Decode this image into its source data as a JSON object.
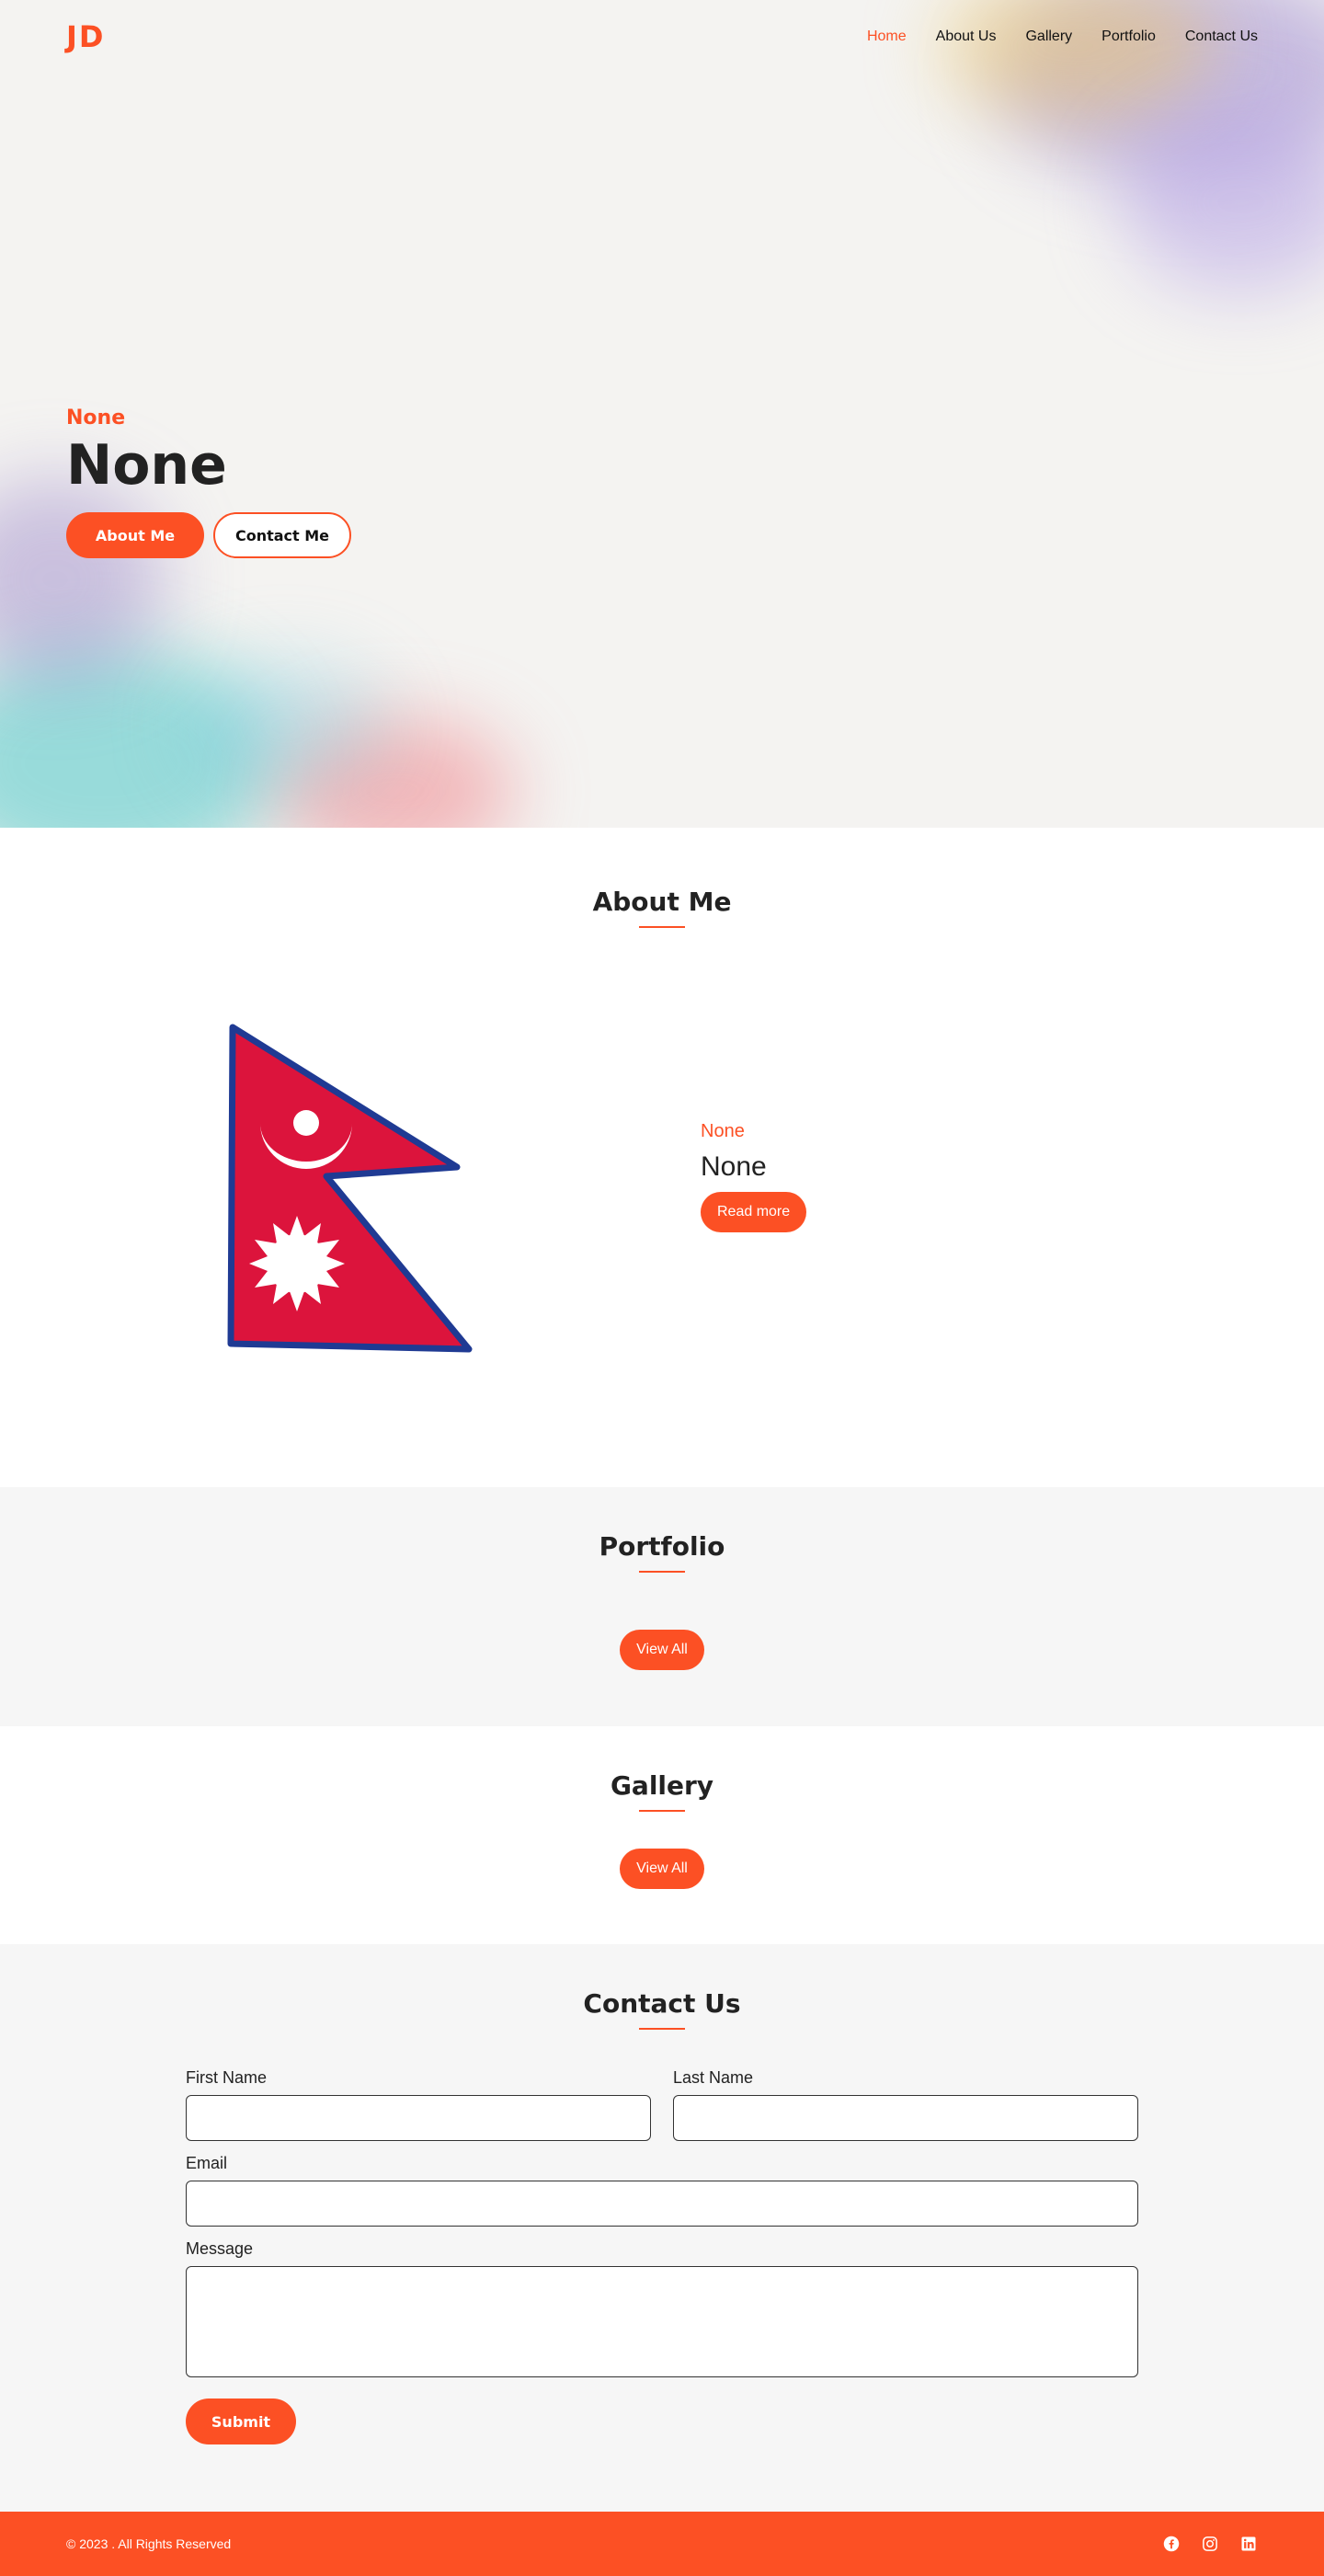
{
  "brand": {
    "logo": "JD",
    "accent_color": "#fc5024"
  },
  "nav": {
    "items": [
      {
        "label": "Home",
        "active": true
      },
      {
        "label": "About Us",
        "active": false
      },
      {
        "label": "Gallery",
        "active": false
      },
      {
        "label": "Portfolio",
        "active": false
      },
      {
        "label": "Contact Us",
        "active": false
      }
    ]
  },
  "hero": {
    "subtitle": "None",
    "title": "None",
    "primary_button": "About Me",
    "secondary_button": "Contact Me"
  },
  "about": {
    "heading": "About Me",
    "image": "nepal-flag",
    "subtitle": "None",
    "title": "None",
    "button": "Read more"
  },
  "portfolio": {
    "heading": "Portfolio",
    "button": "View All"
  },
  "gallery": {
    "heading": "Gallery",
    "button": "View All"
  },
  "contact": {
    "heading": "Contact Us",
    "first_name_label": "First Name",
    "last_name_label": "Last Name",
    "email_label": "Email",
    "message_label": "Message",
    "first_name_value": "",
    "last_name_value": "",
    "email_value": "",
    "message_value": "",
    "submit_label": "Submit"
  },
  "footer": {
    "copyright": "© 2023 . All Rights Reserved",
    "social_icons": [
      "facebook-icon",
      "instagram-icon",
      "linkedin-icon"
    ]
  }
}
